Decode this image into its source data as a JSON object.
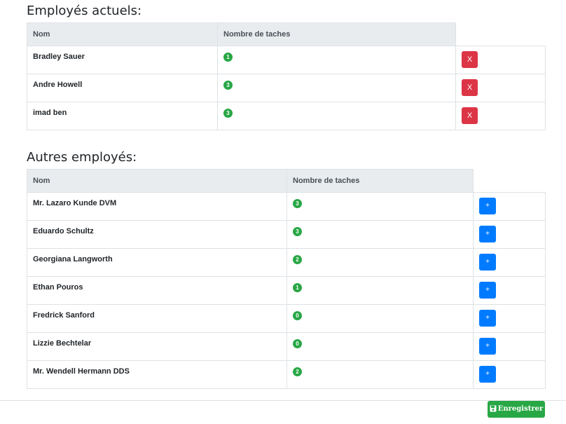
{
  "current": {
    "title": "Employés actuels:",
    "headers": {
      "name": "Nom",
      "tasks": "Nombre de taches"
    },
    "rows": [
      {
        "name": "Bradley Sauer",
        "tasks": "1",
        "action": "X"
      },
      {
        "name": "Andre Howell",
        "tasks": "3",
        "action": "X"
      },
      {
        "name": "imad ben",
        "tasks": "3",
        "action": "X"
      }
    ]
  },
  "others": {
    "title": "Autres employés:",
    "headers": {
      "name": "Nom",
      "tasks": "Nombre de taches"
    },
    "rows": [
      {
        "name": "Mr. Lazaro Kunde DVM",
        "tasks": "3",
        "action": "+"
      },
      {
        "name": "Eduardo Schultz",
        "tasks": "3",
        "action": "+"
      },
      {
        "name": "Georgiana Langworth",
        "tasks": "2",
        "action": "+"
      },
      {
        "name": "Ethan Pouros",
        "tasks": "1",
        "action": "+"
      },
      {
        "name": "Fredrick Sanford",
        "tasks": "0",
        "action": "+"
      },
      {
        "name": "Lizzie Bechtelar",
        "tasks": "0",
        "action": "+"
      },
      {
        "name": "Mr. Wendell Hermann DDS",
        "tasks": "2",
        "action": "+"
      }
    ]
  },
  "footer": {
    "save_label": "Enregistrer",
    "save_icon": "floppy-disk-icon"
  },
  "colors": {
    "badge": "#28a745",
    "remove": "#dc3545",
    "add": "#007bff",
    "save": "#28a745",
    "header_bg": "#e9ecef"
  }
}
